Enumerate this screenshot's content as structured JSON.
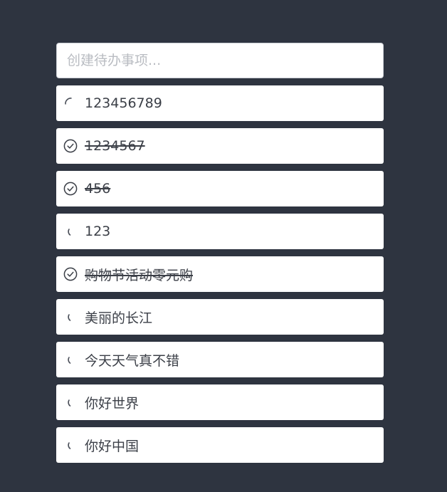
{
  "new_todo": {
    "placeholder": "创建待办事项..."
  },
  "todos": [
    {
      "text": "123456789",
      "status": "loading",
      "icon": "spinner-icon"
    },
    {
      "text": "1234567",
      "status": "completed",
      "icon": "check-circle-icon"
    },
    {
      "text": "456",
      "status": "completed",
      "icon": "check-circle-icon"
    },
    {
      "text": "123",
      "status": "pending",
      "icon": "pending-arc-icon"
    },
    {
      "text": "购物节活动零元购",
      "status": "completed",
      "icon": "check-circle-icon"
    },
    {
      "text": "美丽的长江",
      "status": "pending",
      "icon": "pending-arc-icon"
    },
    {
      "text": "今天天气真不错",
      "status": "pending",
      "icon": "pending-arc-icon"
    },
    {
      "text": "你好世界",
      "status": "pending",
      "icon": "pending-arc-icon"
    },
    {
      "text": "你好中国",
      "status": "pending",
      "icon": "pending-arc-icon"
    }
  ],
  "colors": {
    "background": "#2e3440",
    "item_background": "#ffffff",
    "text": "#3b3f47",
    "icon": "#4a4f59",
    "placeholder": "#b9bcc2"
  }
}
